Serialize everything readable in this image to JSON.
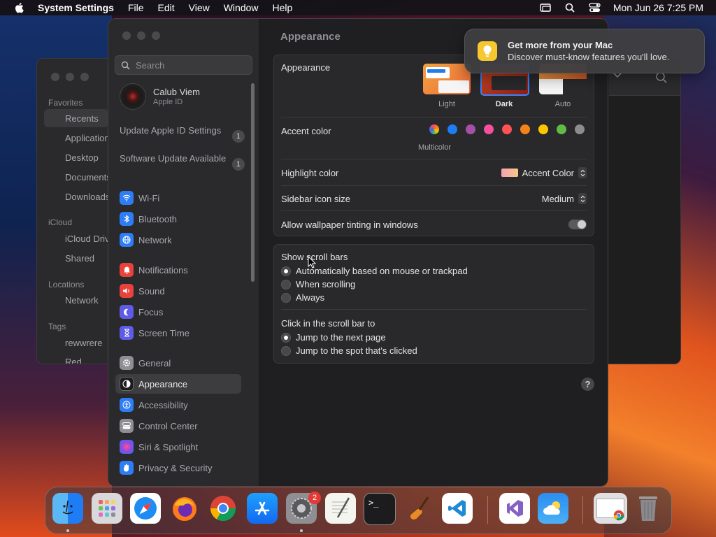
{
  "menubar": {
    "app_name": "System Settings",
    "menus": [
      "File",
      "Edit",
      "View",
      "Window",
      "Help"
    ],
    "datetime": "Mon Jun 26  7:25 PM"
  },
  "finder": {
    "sections": {
      "favorites": "Favorites",
      "icloud": "iCloud",
      "locations": "Locations",
      "tags": "Tags"
    },
    "items": [
      "Recents",
      "Applications",
      "Desktop",
      "Documents",
      "Downloads"
    ],
    "icloud_items": [
      "iCloud Drive",
      "Shared"
    ],
    "location_items": [
      "Network"
    ],
    "tag_items": [
      "rewwrere",
      "Red"
    ]
  },
  "settings": {
    "search_placeholder": "Search",
    "user": {
      "name": "Calub Viem",
      "subtitle": "Apple ID"
    },
    "notices": [
      {
        "label": "Update Apple ID Settings",
        "count": "1"
      },
      {
        "label": "Software Update Available",
        "count": "1"
      }
    ],
    "sidebar": [
      {
        "label": "Wi-Fi",
        "color": "#2f7df6"
      },
      {
        "label": "Bluetooth",
        "color": "#2f7df6"
      },
      {
        "label": "Network",
        "color": "#2f7df6"
      },
      {
        "label": "Notifications",
        "color": "#e9413b"
      },
      {
        "label": "Sound",
        "color": "#e9413b"
      },
      {
        "label": "Focus",
        "color": "#5e5ce6"
      },
      {
        "label": "Screen Time",
        "color": "#5e5ce6"
      },
      {
        "label": "General",
        "color": "#8e8e93"
      },
      {
        "label": "Appearance",
        "color": "#1c1c1e"
      },
      {
        "label": "Accessibility",
        "color": "#2f7df6"
      },
      {
        "label": "Control Center",
        "color": "#8e8e93"
      },
      {
        "label": "Siri & Spotlight",
        "color": "#b04ad8"
      },
      {
        "label": "Privacy & Security",
        "color": "#2f7df6"
      }
    ],
    "page_title": "Appearance",
    "appearance": {
      "label": "Appearance",
      "options": [
        "Light",
        "Dark",
        "Auto"
      ],
      "selected": "Dark"
    },
    "accent": {
      "label": "Accent color",
      "caption": "Multicolor",
      "colors": [
        "#ffffff",
        "#1e7cf5",
        "#a550a7",
        "#f74f9e",
        "#ff5257",
        "#f7821b",
        "#ffc600",
        "#62ba46",
        "#8c8c8c"
      ]
    },
    "highlight": {
      "label": "Highlight color",
      "value": "Accent Color"
    },
    "icon_size": {
      "label": "Sidebar icon size",
      "value": "Medium"
    },
    "tinting": {
      "label": "Allow wallpaper tinting in windows",
      "on": false
    },
    "scrollbars": {
      "label": "Show scroll bars",
      "options": [
        "Automatically based on mouse or trackpad",
        "When scrolling",
        "Always"
      ],
      "selected": 0
    },
    "click_scroll": {
      "label": "Click in the scroll bar to",
      "options": [
        "Jump to the next page",
        "Jump to the spot that's clicked"
      ],
      "selected": 0
    },
    "help": "?"
  },
  "notification": {
    "title": "Get more from your Mac",
    "body": "Discover must-know features you'll love."
  },
  "dock": {
    "apps": [
      "Finder",
      "Launchpad",
      "Safari",
      "Firefox",
      "Chrome",
      "App Store",
      "System Settings",
      "TextEdit",
      "Terminal",
      "GarageBand",
      "VS Code",
      "Visual Studio",
      "Weather",
      "Chrome Window",
      "Trash"
    ],
    "settings_badge": "2"
  }
}
